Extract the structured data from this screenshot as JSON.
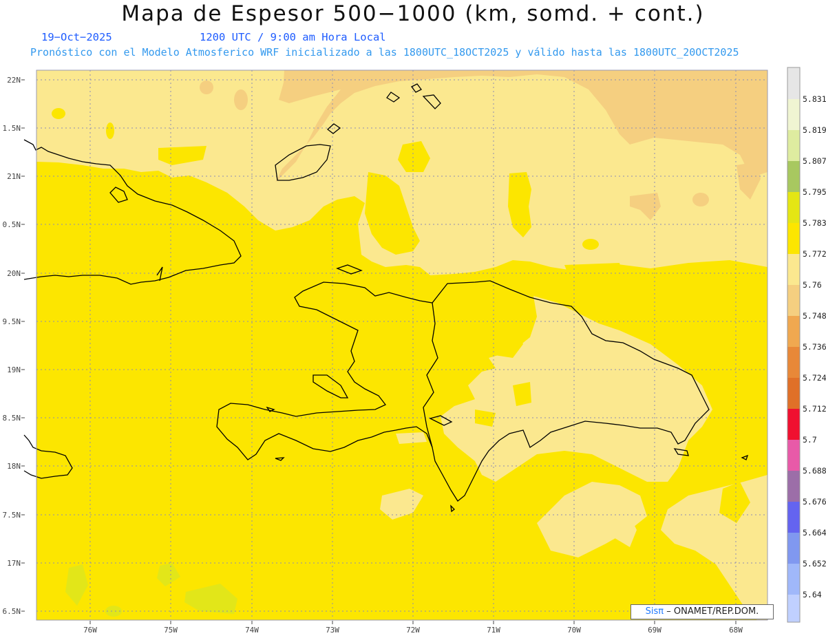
{
  "header": {
    "title": "Mapa de Espesor 500−1000 (km, somd. + cont.)",
    "date": "19−Oct−2025",
    "time": "1200 UTC / 9:00 am Hora Local",
    "model_info": "Pronóstico con el Modelo Atmosferico WRF inicializado a las 1800UTC_18OCT2025 y válido hasta las  1800UTC_20OCT2025"
  },
  "map": {
    "y_axis_labels": [
      "22N",
      "1.5N",
      "21N",
      "0.5N",
      "20N",
      "9.5N",
      "19N",
      "8.5N",
      "18N",
      "7.5N",
      "17N",
      "6.5N"
    ],
    "x_axis_labels": [
      "76W",
      "75W",
      "74W",
      "73W",
      "72W",
      "71W",
      "70W",
      "69W",
      "68W"
    ],
    "colors": {
      "c5748": "#f5cf80",
      "c5760": "#fbe88f",
      "c5772": "#fce600",
      "c5783": "#e2e619",
      "coast": "#000000",
      "grid": "#8c8cb4"
    }
  },
  "colorbar": {
    "levels": [
      "5.831",
      "5.819",
      "5.807",
      "5.795",
      "5.783",
      "5.772",
      "5.76",
      "5.748",
      "5.736",
      "5.724",
      "5.712",
      "5.7",
      "5.688",
      "5.676",
      "5.664",
      "5.652",
      "5.64"
    ],
    "colors": [
      "#e6e6e6",
      "#f0f5d2",
      "#deeca0",
      "#a8c860",
      "#e4e614",
      "#fce600",
      "#fbe88f",
      "#f5cf80",
      "#f0a850",
      "#e88838",
      "#e07028",
      "#f01030",
      "#e85aa8",
      "#9c6ea8",
      "#6464f0",
      "#8098f0",
      "#a0b8fa",
      "#c0d0ff"
    ]
  },
  "credit": {
    "brand": "Sisπ",
    "text": "– ONAMET/REP.DOM."
  }
}
